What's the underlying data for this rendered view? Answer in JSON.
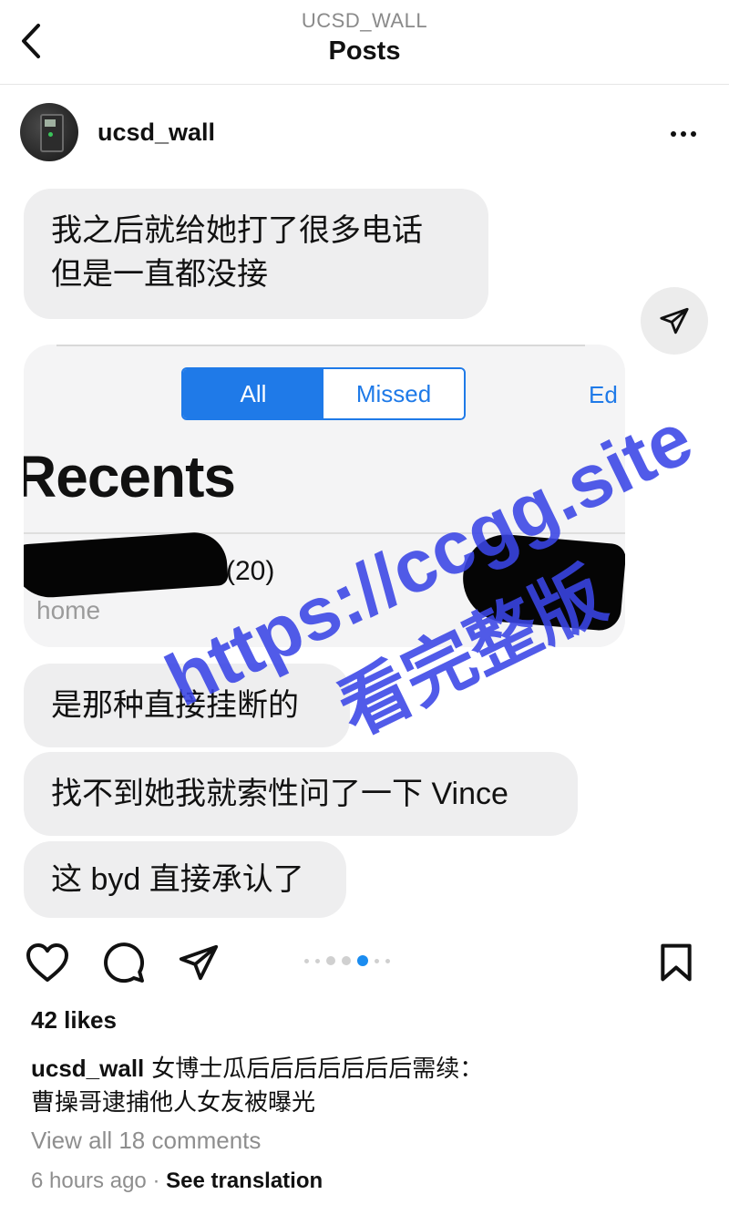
{
  "topbar": {
    "account": "UCSD_WALL",
    "title": "Posts",
    "back_icon": "chevron-left-icon"
  },
  "post": {
    "username": "ucsd_wall",
    "more_icon": "more-horizontal-icon"
  },
  "media": {
    "bubble_1_line_1": "我之后就给她打了很多电话",
    "bubble_1_line_2": "但是一直都没接",
    "screenshot": {
      "segment_all": "All",
      "segment_missed": "Missed",
      "edit": "Ed",
      "heading": "Recents",
      "call_count": "(20)",
      "call_label": "home"
    },
    "bubble_2": "是那种直接挂断的",
    "bubble_3": "找不到她我就索性问了一下 Vince",
    "bubble_4": "这 byd 直接承认了",
    "watermark_url": "https://ccgg.site",
    "watermark_text": "看完整版",
    "share_icon": "send-icon"
  },
  "carousel": {
    "total": 7,
    "active_index": 4
  },
  "actions": {
    "like_icon": "heart-icon",
    "comment_icon": "comment-icon",
    "share_icon": "send-icon",
    "save_icon": "bookmark-icon"
  },
  "likes": "42 likes",
  "caption": {
    "username": "ucsd_wall",
    "line_1": "女博士瓜后后后后后后后需续：",
    "line_2": "曹操哥逮捕他人女友被曝光"
  },
  "view_all_comments": "View all 18 comments",
  "timestamp": "6 hours ago",
  "separator": "·",
  "see_translation": "See translation",
  "colors": {
    "accent": "#1f7ae8",
    "dot_active": "#1a8cf0",
    "watermark": "#3a45e6"
  }
}
